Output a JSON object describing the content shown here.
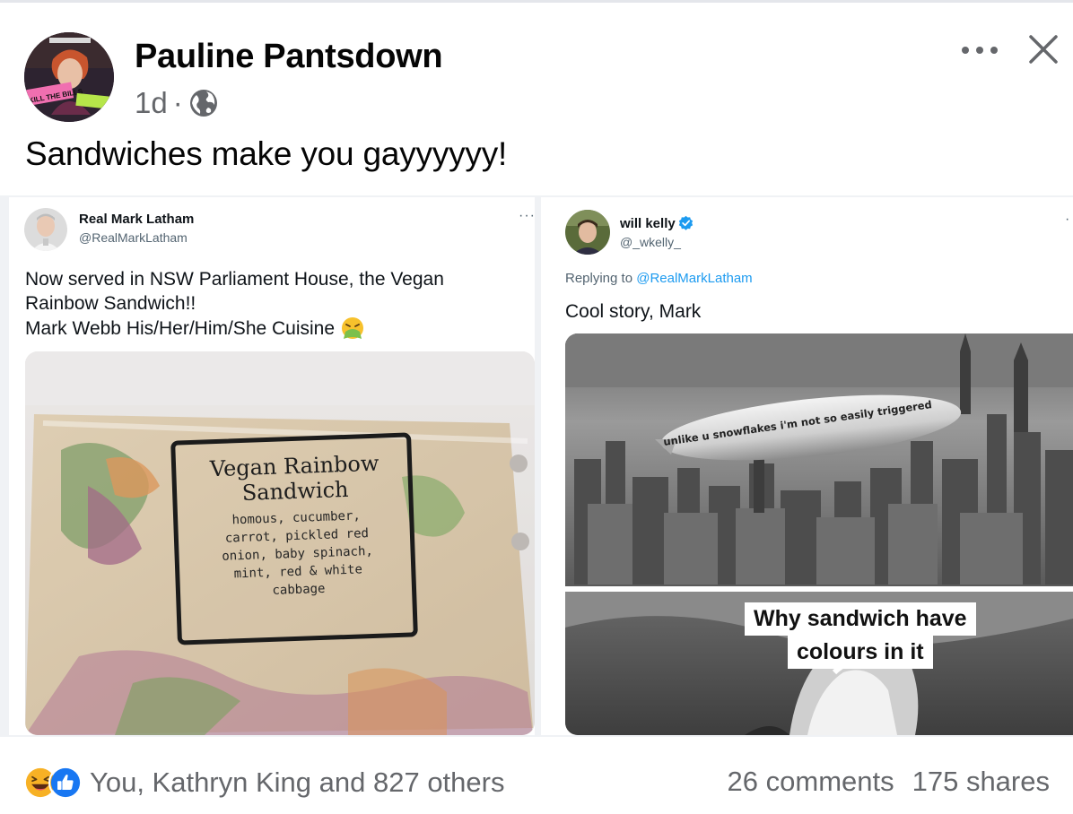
{
  "post": {
    "author": "Pauline Pantsdown",
    "time": "1d",
    "separator": "·",
    "text": "Sandwiches make you gayyyyyy!",
    "avatar_sign_text": "KILL THE BILLS"
  },
  "images": [
    {
      "tweet": {
        "name": "Real Mark Latham",
        "handle": "@RealMarkLatham",
        "more": "···",
        "lines": [
          "Now served in NSW Parliament House, the Vegan",
          "Rainbow Sandwich!!",
          "Mark Webb His/Her/Him/She Cuisine"
        ],
        "emoji": "face-vomiting-icon"
      },
      "photo_label": {
        "title_line1": "Vegan Rainbow",
        "title_line2": "Sandwich",
        "desc_lines": [
          "homous, cucumber,",
          "carrot, pickled red",
          "onion, baby spinach,",
          "mint, red & white",
          "cabbage"
        ]
      }
    },
    {
      "tweet": {
        "name": "will kelly",
        "handle": "@_wkelly_",
        "reply_prefix": "Replying to",
        "reply_handle": "@RealMarkLatham",
        "text": "Cool story, Mark",
        "more": "·"
      },
      "meme": {
        "blimp_text": "unlike u snowflakes i'm not so easily triggered",
        "caption_line1": "Why sandwich have",
        "caption_line2": "colours in it"
      }
    }
  ],
  "footer": {
    "reactions_text": "You, Kathryn King and 827 others",
    "comments": "26 comments",
    "shares": "175 shares"
  },
  "colors": {
    "secondary_text": "#65676b",
    "twitter_blue": "#1d9bf0",
    "like_blue": "#1877f2",
    "haha_yellow": "#f7b125"
  }
}
